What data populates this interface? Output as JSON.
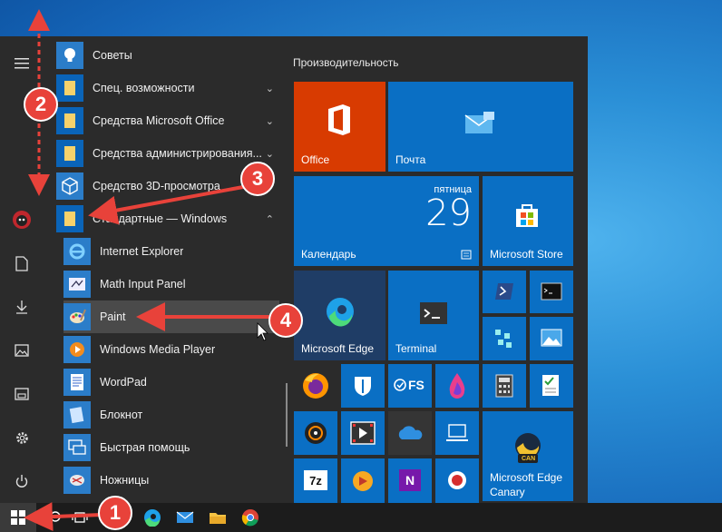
{
  "colors": {
    "tile_blue": "#0a6fc4",
    "office_red": "#d83b01",
    "dark_tile": "#343434",
    "arrow_red": "#e8423a"
  },
  "sidebar": {
    "items": [
      {
        "name": "hamburger-icon"
      },
      {
        "name": "user-avatar-icon"
      },
      {
        "name": "documents-icon"
      },
      {
        "name": "downloads-icon"
      },
      {
        "name": "pictures-icon"
      },
      {
        "name": "file-explorer-icon"
      },
      {
        "name": "settings-icon"
      },
      {
        "name": "power-icon"
      }
    ]
  },
  "apps": [
    {
      "label": "Советы",
      "icon": "lightbulb-icon",
      "chevron": ""
    },
    {
      "label": "Спец. возможности",
      "icon": "folder-icon",
      "chevron": "⌄"
    },
    {
      "label": "Средства Microsoft Office",
      "icon": "folder-icon",
      "chevron": "⌄"
    },
    {
      "label": "Средства администрирования...",
      "icon": "folder-icon",
      "chevron": "⌄"
    },
    {
      "label": "Средство 3D-просмотра",
      "icon": "cube-icon",
      "chevron": ""
    },
    {
      "label": "Стандартные — Windows",
      "icon": "folder-icon",
      "chevron": "⌃"
    },
    {
      "label": "Internet Explorer",
      "icon": "ie-icon",
      "chevron": ""
    },
    {
      "label": "Math Input Panel",
      "icon": "math-panel-icon",
      "chevron": ""
    },
    {
      "label": "Paint",
      "icon": "paint-icon",
      "chevron": ""
    },
    {
      "label": "Windows Media Player",
      "icon": "media-player-icon",
      "chevron": ""
    },
    {
      "label": "WordPad",
      "icon": "wordpad-icon",
      "chevron": ""
    },
    {
      "label": "Блокнот",
      "icon": "notepad-icon",
      "chevron": ""
    },
    {
      "label": "Быстрая помощь",
      "icon": "quick-assist-icon",
      "chevron": ""
    },
    {
      "label": "Ножницы",
      "icon": "scissors-icon",
      "chevron": ""
    }
  ],
  "tiles": {
    "group_title": "Производительность",
    "office": "Office",
    "mail": "Почта",
    "calendar": {
      "day": "пятница",
      "date": "29",
      "label": "Календарь"
    },
    "store": "Microsoft Store",
    "edge": "Microsoft Edge",
    "terminal": "Terminal",
    "edge_canary": "Microsoft Edge Canary",
    "edge_canary_line1": "Microsoft Edge",
    "edge_canary_line2": "Canary",
    "can_badge": "CAN",
    "fs_badge": "FS",
    "sevenzip": "7z",
    "onenote": "N"
  },
  "annotations": {
    "b1": "1",
    "b2": "2",
    "b3": "3",
    "b4": "4"
  }
}
